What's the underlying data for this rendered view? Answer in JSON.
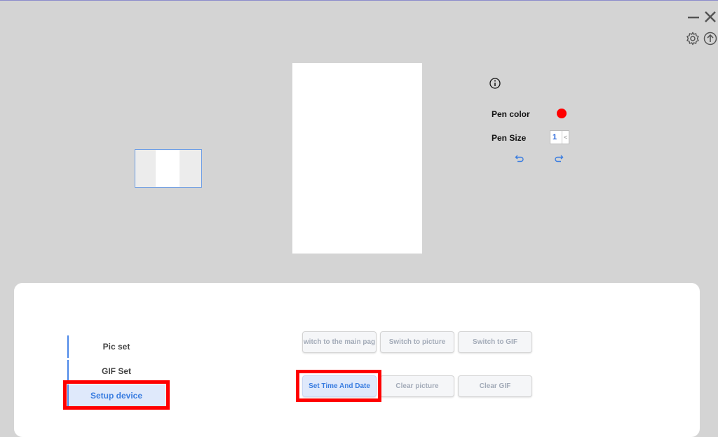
{
  "editor": {
    "pen_color_label": "Pen color",
    "pen_color_value": "#ff0000",
    "pen_size_label": "Pen Size",
    "pen_size_value": "1",
    "pen_size_arrow": "<"
  },
  "window_controls": [
    "minimize-icon",
    "close-icon",
    "gear-icon",
    "upload-icon"
  ],
  "sidebar": {
    "items": [
      {
        "label": "Pic set",
        "active": false
      },
      {
        "label": "GIF Set",
        "active": false
      },
      {
        "label": "Setup device",
        "active": true
      }
    ]
  },
  "buttons": {
    "row1": [
      "witch to the main pag",
      "Switch to picture",
      "Switch to GIF"
    ],
    "row2": [
      "Set Time And Date",
      "Clear picture",
      "Clear GIF"
    ]
  },
  "colors": {
    "accent": "#3a7de0",
    "highlight": "#ff0000"
  }
}
